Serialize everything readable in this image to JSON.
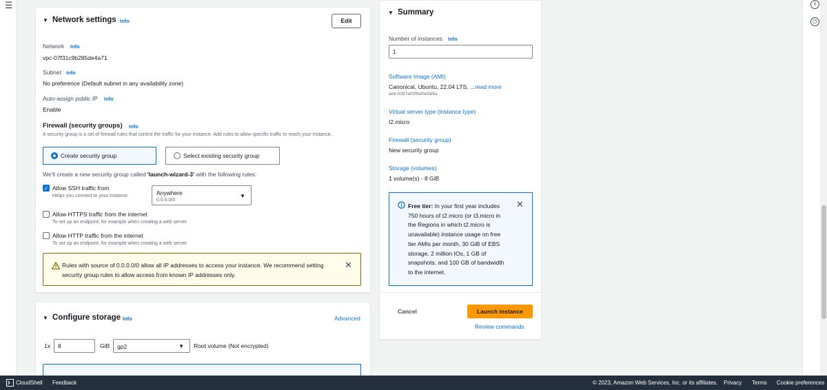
{
  "icons": {
    "menu": "hamburger-menu-icon",
    "info_circle": "info-circle-icon",
    "clock": "clock-icon"
  },
  "network": {
    "title": "Network settings",
    "info": "Info",
    "edit_label": "Edit",
    "network_label": "Network",
    "network_value": "vpc-07f31c9b285de4a71",
    "subnet_label": "Subnet",
    "subnet_value": "No preference (Default subnet in any availability zone)",
    "public_ip_label": "Auto-assign public IP",
    "public_ip_value": "Enable",
    "firewall_title": "Firewall (security groups)",
    "firewall_desc": "A security group is a set of firewall rules that control the traffic for your instance. Add rules to allow specific traffic to reach your instance.",
    "create_sg_label": "Create security group",
    "select_sg_label": "Select existing security group",
    "create_note_prefix": "We'll create a new security group called ",
    "sg_name": "'launch-wizard-3'",
    "create_note_suffix": " with the following rules:",
    "ssh_label": "Allow SSH traffic from",
    "ssh_help": "Helps you connect to your instance",
    "ssh_source": "Anywhere",
    "ssh_cidr": "0.0.0.0/0",
    "https_label": "Allow HTTPS traffic from the internet",
    "https_help": "To set up an endpoint, for example when creating a web server",
    "http_label": "Allow HTTP traffic from the internet",
    "http_help": "To set up an endpoint, for example when creating a web server",
    "warning_text": "Rules with source of 0.0.0.0/0 allow all IP addresses to access your instance. We recommend setting security group rules to allow access from known IP addresses only."
  },
  "storage": {
    "title": "Configure storage",
    "info": "Info",
    "advanced": "Advanced",
    "multiplier": "1x",
    "size": "8",
    "unit": "GiB",
    "volume_type": "gp2",
    "root_label": "Root volume  (Not encrypted)"
  },
  "summary": {
    "title": "Summary",
    "instances_label": "Number of instances",
    "info": "Info",
    "instances_value": "1",
    "ami_label": "Software Image (AMI)",
    "ami_value": "Canonical, Ubuntu, 22.04 LTS, ...",
    "ami_more": "read more",
    "ami_id": "ami-0287a05f0ef0e9d9a",
    "type_label": "Virtual server type (instance type)",
    "type_value": "t2.micro",
    "firewall_label": "Firewall (security group)",
    "firewall_value": "New security group",
    "storage_label": "Storage (volumes)",
    "storage_value": "1 volume(s) - 8 GiB",
    "free_tier_bold": "Free tier:",
    "free_tier_line1": " In your first year includes",
    "free_tier_lines": [
      "750 hours of t2.micro (or t3.micro in",
      "the Regions in which t2.micro is",
      "unavailable) instance usage on free",
      "tier AMIs per month, 30 GiB of EBS",
      "storage, 2 million IOs, 1 GB of",
      "snapshots, and 100 GB of bandwidth",
      "to the internet."
    ],
    "cancel": "Cancel",
    "launch": "Launch instance",
    "review": "Review commands"
  },
  "footer": {
    "cloudshell": "CloudShell",
    "feedback": "Feedback",
    "copyright": "© 2023, Amazon Web Services, Inc. or its affiliates.",
    "privacy": "Privacy",
    "terms": "Terms",
    "cookies": "Cookie preferences"
  }
}
